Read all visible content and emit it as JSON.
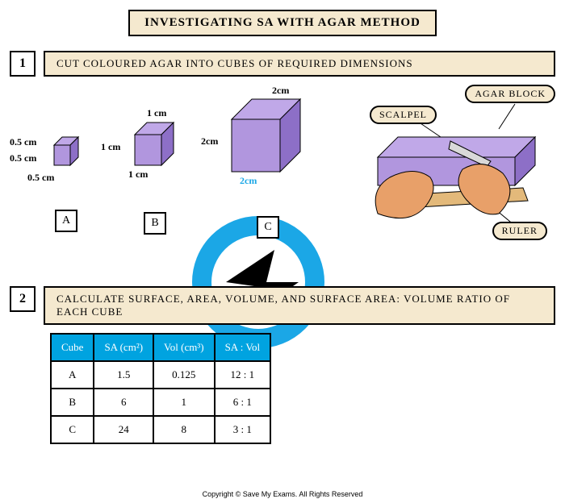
{
  "title": "INVESTIGATING SA WITH AGAR METHOD",
  "steps": {
    "s1": {
      "num": "1",
      "text": "CUT COLOURED AGAR INTO CUBES OF REQUIRED DIMENSIONS"
    },
    "s2": {
      "num": "2",
      "text": "CALCULATE SURFACE, AREA, VOLUME, AND SURFACE AREA: VOLUME RATIO OF EACH CUBE"
    }
  },
  "cubes": {
    "a": {
      "label": "A",
      "d1": "0.5 cm",
      "d2": "0.5 cm",
      "d3": "0.5 cm"
    },
    "b": {
      "label": "B",
      "d1": "1 cm",
      "d2": "1 cm",
      "d3": "1 cm"
    },
    "c": {
      "label": "C",
      "d1": "2cm",
      "d2": "2cm",
      "d3": "2cm"
    }
  },
  "tags": {
    "scalpel": "SCALPEL",
    "agar_block": "AGAR BLOCK",
    "ruler": "RULER"
  },
  "chart_data": {
    "type": "table",
    "title": "SA:Vol for agar cubes",
    "headers": [
      "Cube",
      "SA (cm²)",
      "Vol (cm³)",
      "SA : Vol"
    ],
    "rows": [
      [
        "A",
        "1.5",
        "0.125",
        "12 : 1"
      ],
      [
        "B",
        "6",
        "1",
        "6 : 1"
      ],
      [
        "C",
        "24",
        "8",
        "3 : 1"
      ]
    ]
  },
  "copyright": "Copyright © Save My Exams. All Rights Reserved"
}
